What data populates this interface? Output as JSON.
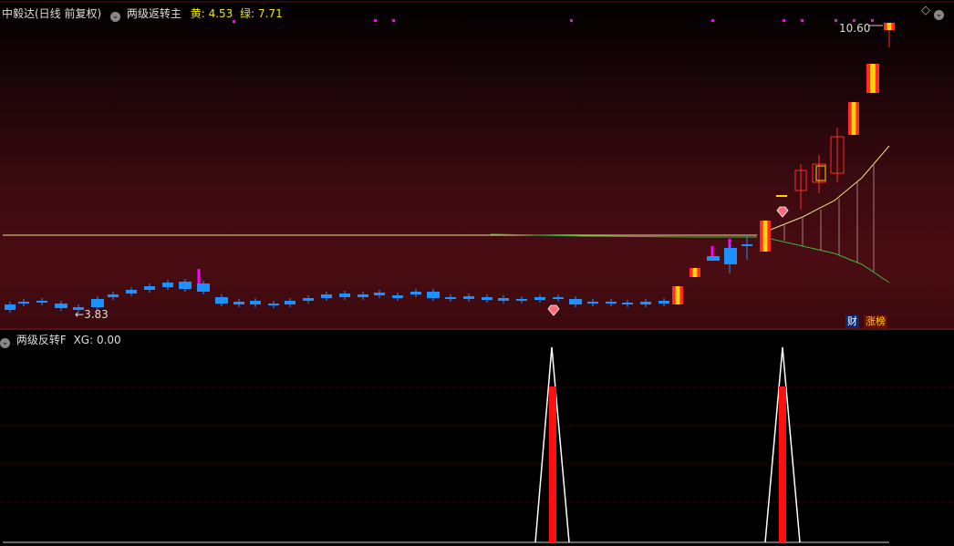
{
  "header": {
    "title": "中毅达(日线 前复权)",
    "indicator_name": "两级返转主",
    "yellow_label": "黄:",
    "yellow_value": "4.53",
    "green_label": "绿:",
    "green_value": "7.71"
  },
  "main_chart": {
    "high_label": "10.60",
    "low_label": "3.83",
    "tags": {
      "cai": "财",
      "zhangbang": "涨榜"
    },
    "colors": {
      "up": "#ff2a2a",
      "down": "#1e90ff",
      "limit_up": "#ffd400",
      "magenta": "#ff00ff"
    }
  },
  "sub_chart": {
    "title": "两级反转F",
    "xg_label": "XG:",
    "xg_value": "0.00"
  },
  "icons": {
    "diamond": "diamond-icon",
    "gem": "gem-signal-icon",
    "settings": "circle-toggle-icon"
  },
  "chart_data": {
    "type": "candlestick",
    "title": "中毅达(日线 前复权)",
    "high": 10.6,
    "low": 3.83,
    "indicators": [
      {
        "name": "黄",
        "value": 4.53
      },
      {
        "name": "绿",
        "value": 7.71
      },
      {
        "name": "XG",
        "value": 0.0
      }
    ]
  }
}
